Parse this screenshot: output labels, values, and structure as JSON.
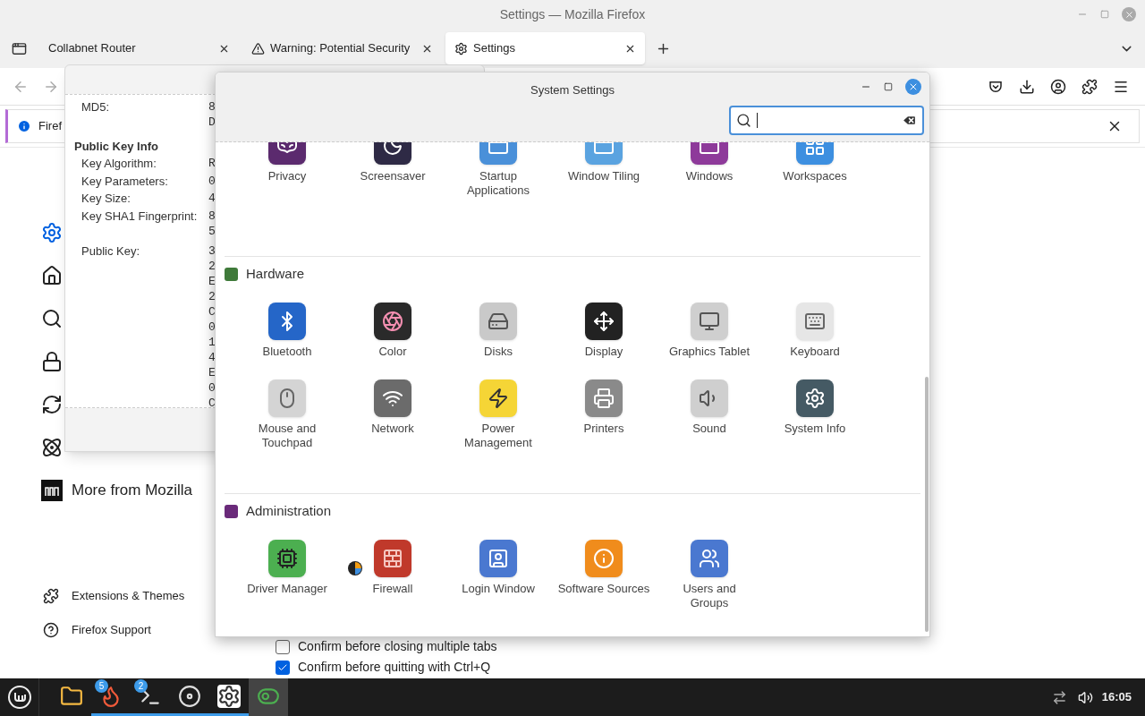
{
  "browser": {
    "title": "Settings — Mozilla Firefox",
    "tabs": [
      {
        "label": "Collabnet Router",
        "kind": "plain",
        "selected": false
      },
      {
        "label": "Warning: Potential Security",
        "kind": "warning",
        "selected": false
      },
      {
        "label": "Settings",
        "kind": "settings",
        "selected": true
      }
    ],
    "notification": {
      "text": "Firef"
    },
    "sidebar": [
      {
        "kind": "general",
        "selected": true
      },
      {
        "kind": "home",
        "selected": false
      },
      {
        "kind": "search",
        "selected": false
      },
      {
        "kind": "privacy",
        "selected": false
      },
      {
        "kind": "sync",
        "selected": false
      },
      {
        "kind": "labs",
        "selected": false
      },
      {
        "kind": "mozilla",
        "label": "More from Mozilla",
        "selected": false
      }
    ],
    "footer_links": [
      {
        "kind": "extensions",
        "label": "Extensions & Themes"
      },
      {
        "kind": "support",
        "label": "Firefox Support"
      }
    ],
    "checkboxes": [
      {
        "label": "Confirm before closing multiple tabs",
        "checked": false
      },
      {
        "label": "Confirm before quitting with Ctrl+Q",
        "checked": true
      }
    ]
  },
  "certificate_dialog": {
    "lines": [
      {
        "kind": "field",
        "label": "MD5:",
        "values": [
          "8",
          "D"
        ]
      },
      {
        "kind": "heading",
        "label": "Public Key Info"
      },
      {
        "kind": "field",
        "label": "Key Algorithm:",
        "values": [
          "R"
        ]
      },
      {
        "kind": "field",
        "label": "Key Parameters:",
        "values": [
          "0"
        ]
      },
      {
        "kind": "field",
        "label": "Key Size:",
        "values": [
          "4"
        ]
      },
      {
        "kind": "field",
        "label": "Key SHA1 Fingerprint:",
        "values": [
          "8",
          "5"
        ]
      },
      {
        "kind": "field_spaced",
        "label": "Public Key:",
        "values": [
          "3",
          "2",
          "E",
          "2",
          "C",
          "0",
          "1",
          "4",
          "E",
          "0",
          "C"
        ]
      }
    ]
  },
  "system_settings": {
    "title": "System Settings",
    "sections": [
      {
        "items": [
          {
            "label": "Privacy",
            "kind": "privacy"
          },
          {
            "label": "Screensaver",
            "kind": "screensaver"
          },
          {
            "label": "Startup Applications",
            "kind": "startup"
          },
          {
            "label": "Window Tiling",
            "kind": "tiling"
          },
          {
            "label": "Windows",
            "kind": "windows"
          },
          {
            "label": "Workspaces",
            "kind": "workspaces"
          }
        ]
      },
      {
        "title": "Hardware",
        "kind": "hardware",
        "items": [
          {
            "label": "Bluetooth",
            "kind": "bluetooth"
          },
          {
            "label": "Color",
            "kind": "color"
          },
          {
            "label": "Disks",
            "kind": "disks"
          },
          {
            "label": "Display",
            "kind": "display"
          },
          {
            "label": "Graphics Tablet",
            "kind": "tablet"
          },
          {
            "label": "Keyboard",
            "kind": "keyboard"
          },
          {
            "label": "Mouse and Touchpad",
            "kind": "mouse"
          },
          {
            "label": "Network",
            "kind": "network"
          },
          {
            "label": "Power Management",
            "kind": "power"
          },
          {
            "label": "Printers",
            "kind": "printers"
          },
          {
            "label": "Sound",
            "kind": "sound"
          },
          {
            "label": "System Info",
            "kind": "sysinfo"
          }
        ]
      },
      {
        "title": "Administration",
        "kind": "admin",
        "items": [
          {
            "label": "Driver Manager",
            "kind": "driver"
          },
          {
            "label": "Firewall",
            "kind": "firewall"
          },
          {
            "label": "Login Window",
            "kind": "login"
          },
          {
            "label": "Software Sources",
            "kind": "sources"
          },
          {
            "label": "Users and Groups",
            "kind": "users"
          }
        ]
      }
    ]
  },
  "taskbar": {
    "items": [
      {
        "kind": "folder",
        "running": false,
        "selected": false
      },
      {
        "kind": "firefox",
        "badge": "5",
        "running": true,
        "selected": false
      },
      {
        "kind": "terminal",
        "badge": "2",
        "running": true,
        "selected": false
      },
      {
        "kind": "disc",
        "running": true,
        "selected": false
      },
      {
        "kind": "settings",
        "running": true,
        "selected": false
      },
      {
        "kind": "toggles",
        "running": false,
        "selected": true
      }
    ],
    "clock": "16:05"
  }
}
